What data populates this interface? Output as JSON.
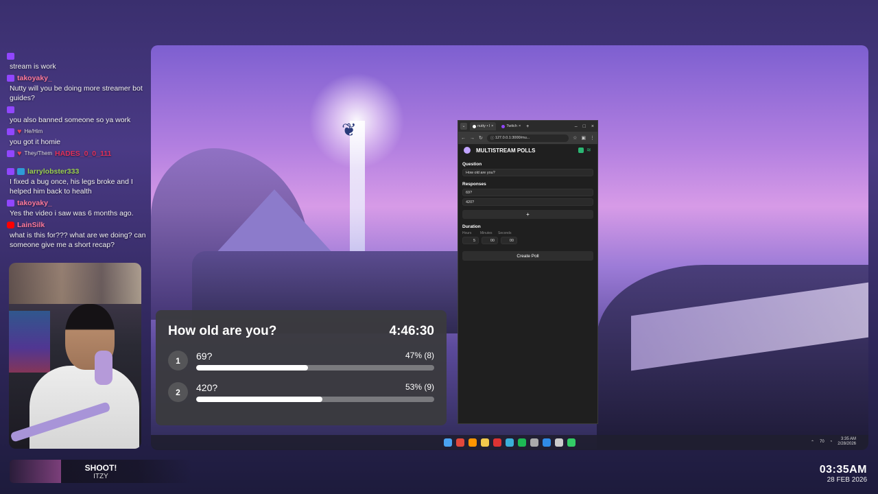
{
  "chat": {
    "messages": [
      {
        "user": "",
        "color": "#9aa0ff",
        "badges": [
          "twitch"
        ],
        "pronoun": "",
        "text": "stream is work"
      },
      {
        "user": "takoyaky_",
        "color": "#ff7a9c",
        "badges": [
          "twitch"
        ],
        "pronoun": "",
        "text": "Nutty will you be doing more streamer bot guides?"
      },
      {
        "user": "",
        "color": "#7b6cff",
        "badges": [
          "twitch"
        ],
        "pronoun": "",
        "text": "you also banned someone so ya work"
      },
      {
        "user": "",
        "color": "#3aa8a0",
        "badges": [
          "twitch",
          "heart"
        ],
        "pronoun": "He/Him",
        "text": "you got it homie"
      },
      {
        "user": "HADES_0_0_111",
        "color": "#e0305a",
        "badges": [
          "twitch",
          "heart"
        ],
        "pronoun": "They/Them",
        "text": ""
      },
      {
        "user": "larrylobster333",
        "color": "#9bd14f",
        "badges": [
          "twitch",
          "prime"
        ],
        "pronoun": "",
        "text": "I fixed a bug once, his legs broke and I helped him back to health"
      },
      {
        "user": "takoyaky_",
        "color": "#ff7a9c",
        "badges": [
          "twitch"
        ],
        "pronoun": "",
        "text": "Yes the video i saw was 6 months ago."
      },
      {
        "user": "LainSilk",
        "color": "#ff7a9c",
        "badges": [
          "yt"
        ],
        "pronoun": "",
        "text": "what is this for??? what are we doing? can someone give me a short recap?"
      }
    ]
  },
  "now_playing": {
    "title": "SHOOT!",
    "artist": "ITZY"
  },
  "clock": {
    "time": "03:35AM",
    "date": "28 FEB 2026"
  },
  "poll": {
    "question": "How old are you?",
    "timer": "4:46:30",
    "options": [
      {
        "num": "1",
        "label": "69?",
        "pct_text": "47% (8)",
        "fraction": 0.47
      },
      {
        "num": "2",
        "label": "420?",
        "pct_text": "53% (9)",
        "fraction": 0.53
      }
    ]
  },
  "browser": {
    "tabs": [
      {
        "label": "nutty • l",
        "active": true
      },
      {
        "label": "Twitch",
        "active": false
      }
    ],
    "url": "127.0.0.1:3000/mu...",
    "app_title": "MULTISTREAM POLLS",
    "question_label": "Question",
    "question_value": "How old are you?",
    "responses_label": "Responses",
    "responses": [
      "69?",
      "420?"
    ],
    "add_label": "+",
    "duration_label": "Duration",
    "duration": {
      "hours_label": "Hours",
      "minutes_label": "Minutes",
      "seconds_label": "Seconds",
      "hours": "5",
      "minutes": "00",
      "seconds": "00"
    },
    "create_label": "Create Poll"
  },
  "taskbar": {
    "icons": [
      "windows-icon",
      "chrome-icon",
      "firefox-icon",
      "folder-icon",
      "obs-icon",
      "edge-icon",
      "spotify-icon",
      "unity-icon",
      "vscode-icon",
      "settings-icon",
      "app-icon"
    ],
    "icon_colors": [
      "#4aa3f0",
      "#e2483b",
      "#ff9500",
      "#f2c94c",
      "#d33",
      "#3bb0d9",
      "#1db954",
      "#aaa",
      "#2f8be6",
      "#ccc",
      "#3c6"
    ],
    "tray_temp": "70",
    "tray_time": "3:35 AM",
    "tray_date": "2/28/2026"
  }
}
